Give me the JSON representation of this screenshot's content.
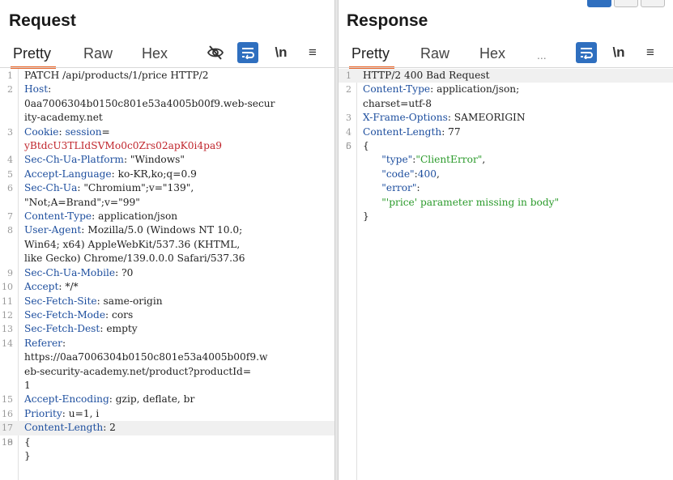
{
  "request": {
    "title": "Request",
    "tabs": [
      "Pretty",
      "Raw",
      "Hex"
    ],
    "lines": [
      {
        "n": "1",
        "parts": [
          [
            "v",
            "PATCH /api/products/1/price HTTP/2"
          ]
        ]
      },
      {
        "n": "2",
        "parts": [
          [
            "k",
            "Host"
          ],
          [
            "v",
            ":"
          ]
        ]
      },
      {
        "n": "",
        "parts": [
          [
            "v",
            "0aa7006304b0150c801e53a4005b00f9.web-secur"
          ]
        ]
      },
      {
        "n": "",
        "parts": [
          [
            "v",
            "ity-academy.net"
          ]
        ]
      },
      {
        "n": "3",
        "parts": [
          [
            "k",
            "Cookie"
          ],
          [
            "v",
            ": "
          ],
          [
            "k",
            "session"
          ],
          [
            "v",
            "="
          ]
        ]
      },
      {
        "n": "",
        "parts": [
          [
            "red",
            "yBtdcU3TLIdSVMo0c0Zrs02apK0i4pa9"
          ]
        ]
      },
      {
        "n": "4",
        "parts": [
          [
            "k",
            "Sec-Ch-Ua-Platform"
          ],
          [
            "v",
            ": \"Windows\""
          ]
        ]
      },
      {
        "n": "5",
        "parts": [
          [
            "k",
            "Accept-Language"
          ],
          [
            "v",
            ": ko-KR,ko;q=0.9"
          ]
        ]
      },
      {
        "n": "6",
        "parts": [
          [
            "k",
            "Sec-Ch-Ua"
          ],
          [
            "v",
            ": \"Chromium\";v=\"139\","
          ]
        ]
      },
      {
        "n": "",
        "parts": [
          [
            "v",
            "\"Not;A=Brand\";v=\"99\""
          ]
        ]
      },
      {
        "n": "7",
        "parts": [
          [
            "k",
            "Content-Type"
          ],
          [
            "v",
            ": application/json"
          ]
        ]
      },
      {
        "n": "8",
        "parts": [
          [
            "k",
            "User-Agent"
          ],
          [
            "v",
            ": Mozilla/5.0 (Windows NT 10.0;"
          ]
        ]
      },
      {
        "n": "",
        "parts": [
          [
            "v",
            "Win64; x64) AppleWebKit/537.36 (KHTML,"
          ]
        ]
      },
      {
        "n": "",
        "parts": [
          [
            "v",
            "like Gecko) Chrome/139.0.0.0 Safari/537.36"
          ]
        ]
      },
      {
        "n": "9",
        "parts": [
          [
            "k",
            "Sec-Ch-Ua-Mobile"
          ],
          [
            "v",
            ": ?0"
          ]
        ]
      },
      {
        "n": "10",
        "parts": [
          [
            "k",
            "Accept"
          ],
          [
            "v",
            ": */*"
          ]
        ]
      },
      {
        "n": "11",
        "parts": [
          [
            "k",
            "Sec-Fetch-Site"
          ],
          [
            "v",
            ": same-origin"
          ]
        ]
      },
      {
        "n": "12",
        "parts": [
          [
            "k",
            "Sec-Fetch-Mode"
          ],
          [
            "v",
            ": cors"
          ]
        ]
      },
      {
        "n": "13",
        "parts": [
          [
            "k",
            "Sec-Fetch-Dest"
          ],
          [
            "v",
            ": empty"
          ]
        ]
      },
      {
        "n": "14",
        "parts": [
          [
            "k",
            "Referer"
          ],
          [
            "v",
            ":"
          ]
        ]
      },
      {
        "n": "",
        "parts": [
          [
            "v",
            "https://0aa7006304b0150c801e53a4005b00f9.w"
          ]
        ]
      },
      {
        "n": "",
        "parts": [
          [
            "v",
            "eb-security-academy.net/product?productId="
          ]
        ]
      },
      {
        "n": "",
        "parts": [
          [
            "v",
            "1"
          ]
        ]
      },
      {
        "n": "15",
        "parts": [
          [
            "k",
            "Accept-Encoding"
          ],
          [
            "v",
            ": gzip, deflate, br"
          ]
        ]
      },
      {
        "n": "16",
        "parts": [
          [
            "k",
            "Priority"
          ],
          [
            "v",
            ": u=1, i"
          ]
        ]
      },
      {
        "n": "17",
        "cur": true,
        "parts": [
          [
            "k",
            "Content-Length"
          ],
          [
            "v",
            ": 2"
          ]
        ]
      },
      {
        "n": "18",
        "parts": [
          [
            "v",
            ""
          ]
        ]
      },
      {
        "n": "19",
        "parts": [
          [
            "v",
            "{"
          ]
        ]
      },
      {
        "n": "",
        "parts": [
          [
            "v",
            "}"
          ]
        ]
      }
    ]
  },
  "response": {
    "title": "Response",
    "tabs": [
      "Pretty",
      "Raw",
      "Hex",
      "..."
    ],
    "lines": [
      {
        "n": "1",
        "cur": true,
        "parts": [
          [
            "v",
            "HTTP/2 400 Bad Request"
          ]
        ]
      },
      {
        "n": "2",
        "parts": [
          [
            "k",
            "Content-Type"
          ],
          [
            "v",
            ": application/json;"
          ]
        ]
      },
      {
        "n": "",
        "parts": [
          [
            "v",
            "charset=utf-8"
          ]
        ]
      },
      {
        "n": "3",
        "parts": [
          [
            "k",
            "X-Frame-Options"
          ],
          [
            "v",
            ": SAMEORIGIN"
          ]
        ]
      },
      {
        "n": "4",
        "parts": [
          [
            "k",
            "Content-Length"
          ],
          [
            "v",
            ": 77"
          ]
        ]
      },
      {
        "n": "5",
        "parts": [
          [
            "v",
            ""
          ]
        ]
      },
      {
        "n": "6",
        "parts": [
          [
            "v",
            "{"
          ]
        ]
      },
      {
        "n": "",
        "parts": [
          [
            "v",
            "      "
          ],
          [
            "k",
            "\"type\""
          ],
          [
            "v",
            ":"
          ],
          [
            "str",
            "\"ClientError\""
          ],
          [
            "v",
            ","
          ]
        ]
      },
      {
        "n": "",
        "parts": [
          [
            "v",
            "      "
          ],
          [
            "k",
            "\"code\""
          ],
          [
            "v",
            ":"
          ],
          [
            "k",
            "400"
          ],
          [
            "v",
            ","
          ]
        ]
      },
      {
        "n": "",
        "parts": [
          [
            "v",
            "      "
          ],
          [
            "k",
            "\"error\""
          ],
          [
            "v",
            ":"
          ]
        ]
      },
      {
        "n": "",
        "parts": [
          [
            "v",
            "      "
          ],
          [
            "str",
            "\"'price' parameter missing in body\""
          ]
        ]
      },
      {
        "n": "",
        "parts": [
          [
            "v",
            "}"
          ]
        ]
      }
    ]
  },
  "icons": {
    "hide": "eye-slash-icon",
    "wrap": "word-wrap-icon",
    "newline": "newline-icon",
    "menu": "hamburger-menu-icon"
  },
  "toolbar_labels": {
    "newline": "\\n",
    "menu": "≡"
  }
}
